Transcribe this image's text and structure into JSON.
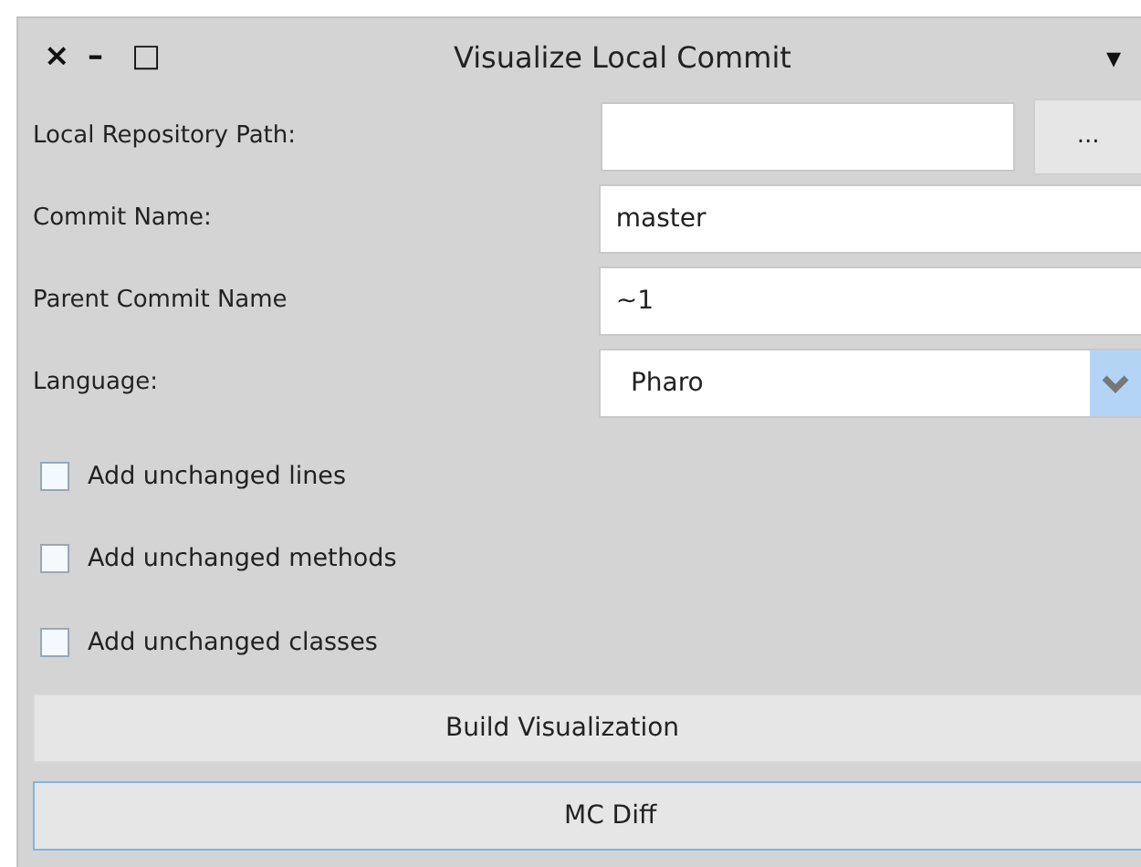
{
  "window": {
    "title": "Visualize Local Commit",
    "close": "×",
    "minimize": "–",
    "maximize": "□",
    "menu": "▾"
  },
  "fields": [
    {
      "kind": "path",
      "label": "Local Repository Path:",
      "button": "..."
    },
    {
      "kind": "text",
      "label": "Commit Name:",
      "value": "master"
    },
    {
      "kind": "text",
      "label": "Parent Commit Name",
      "value": "~1"
    },
    {
      "kind": "dropdown",
      "label": "Language:",
      "value": "Pharo"
    }
  ],
  "checkboxes": [
    {
      "label": "Add unchanged lines",
      "checked": false
    },
    {
      "label": "Add unchanged methods",
      "checked": false
    },
    {
      "label": "Add unchanged classes",
      "checked": false
    }
  ],
  "buttons": [
    {
      "label": "Build Visualization",
      "focused": false
    },
    {
      "label": "MC Diff",
      "focused": true
    }
  ]
}
